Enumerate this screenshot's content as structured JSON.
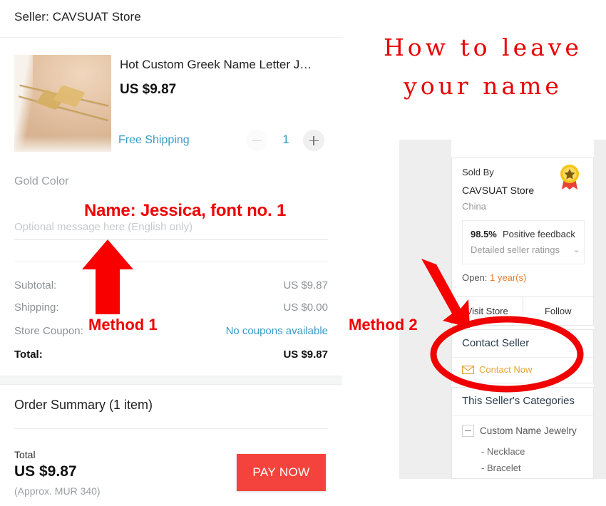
{
  "checkout": {
    "seller_header": "Seller: CAVSUAT Store",
    "product": {
      "title": "Hot Custom Greek Name Letter J…",
      "price": "US $9.87",
      "shipping_label": "Free Shipping",
      "quantity": "1",
      "minus_icon": "minus-icon",
      "plus_icon": "plus-icon",
      "variant": "Gold Color",
      "image_alt": "gold-name-bracelets-on-wrist"
    },
    "message_field": {
      "placeholder": "Optional message here (English only)",
      "value": ""
    },
    "price_rows": [
      {
        "label": "Subtotal:",
        "value": "US $9.87"
      },
      {
        "label": "Shipping:",
        "value": "US $0.00"
      },
      {
        "label": "Store Coupon:",
        "value": "No coupons available"
      },
      {
        "label": "Total:",
        "value": "US $9.87"
      }
    ],
    "order_summary": {
      "title": "Order Summary (1 item)",
      "total_label": "Total",
      "total_amount": "US $9.87",
      "total_approx": "(Approx. MUR 340)",
      "pay_button": "PAY NOW"
    }
  },
  "seller_panel": {
    "sold_by_label": "Sold By",
    "seller_name": "CAVSUAT Store",
    "country": "China",
    "badge_icon": "top-seller-medal-icon",
    "feedback_percent": "98.5%",
    "feedback_text": "Positive feedback",
    "ratings_link": "Detailed seller ratings",
    "ratings_caret": "⌄",
    "open_label": "Open:",
    "open_years": "1 year(s)",
    "visit_store": "Visit Store",
    "follow": "Follow",
    "contact_seller_title": "Contact Seller",
    "contact_now": "Contact Now",
    "envelope_icon": "envelope-icon",
    "categories_title": "This Seller's Categories",
    "category_root": "Custom Name Jewelry",
    "category_children": [
      "- Necklace",
      "- Bracelet"
    ]
  },
  "annotations": {
    "headline_line1": "How to leave",
    "headline_line2": "your name",
    "name_note": "Name: Jessica, font no. 1",
    "method1": "Method 1",
    "method2": "Method 2",
    "arrow1_name": "up-arrow-annotation",
    "arrow2_name": "diagonal-arrow-annotation",
    "ellipse_name": "highlight-ellipse-annotation"
  },
  "colors": {
    "annotation_red": "#f00000",
    "headline_red": "#e80000",
    "pay_button": "#f4433c",
    "link_blue": "#3a9cc4",
    "orange": "#e8a33a"
  }
}
